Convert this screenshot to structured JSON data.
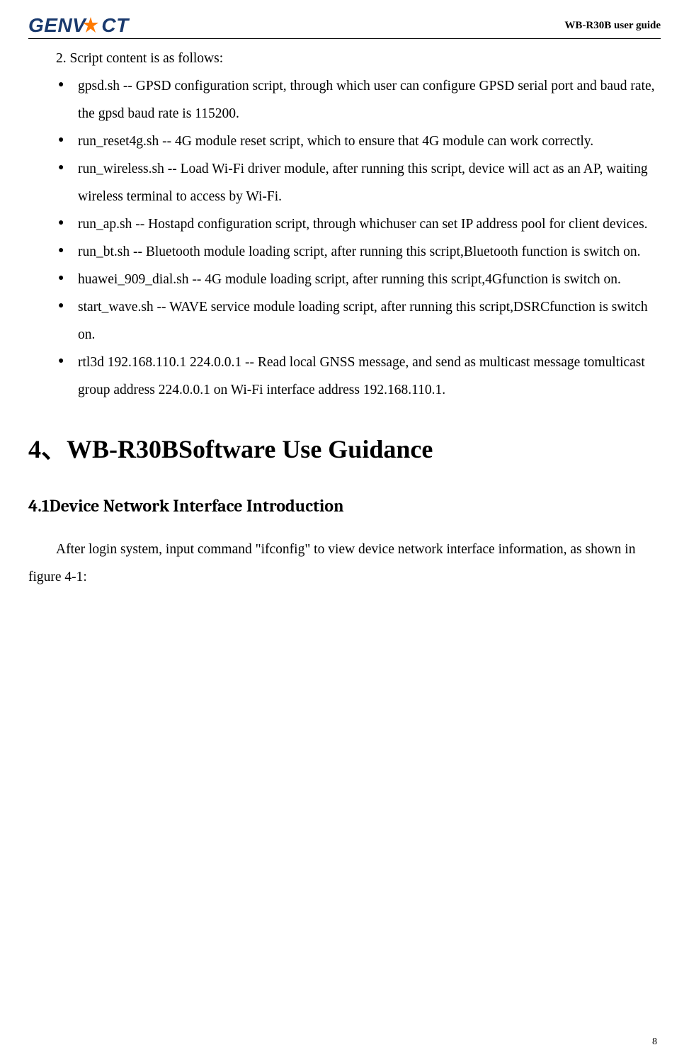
{
  "header": {
    "logo_text": "GENV   CT",
    "title": "WB-R30B user guide"
  },
  "intro": "2. Script content is as follows:",
  "bullets": [
    "gpsd.sh -- GPSD configuration script, through which user can configure GPSD serial port and baud rate, the gpsd baud rate is 115200.",
    "run_reset4g.sh -- 4G module reset script, which to ensure that 4G module can work correctly.",
    "run_wireless.sh -- Load Wi-Fi driver module, after running this script, device will act as an AP, waiting wireless terminal to access by Wi-Fi.",
    "run_ap.sh -- Hostapd configuration script, through whichuser can set IP address pool for client devices.",
    "run_bt.sh -- Bluetooth module loading script, after running this script,Bluetooth function is switch on.",
    "huawei_909_dial.sh -- 4G module loading script, after running this script,4Gfunction is switch on.",
    "start_wave.sh -- WAVE service module loading script, after running this script,DSRCfunction is switch on.",
    "rtl3d 192.168.110.1 224.0.0.1 -- Read local GNSS message, and send as multicast message tomulticast group address 224.0.0.1 on Wi-Fi interface address 192.168.110.1."
  ],
  "section_heading": "4、WB-R30BSoftware Use Guidance",
  "subsection_heading": "4.1Device Network Interface Introduction",
  "paragraph": "After login system, input command \"ifconfig\" to view device network interface information, as shown in figure 4-1:",
  "page_number": "8"
}
